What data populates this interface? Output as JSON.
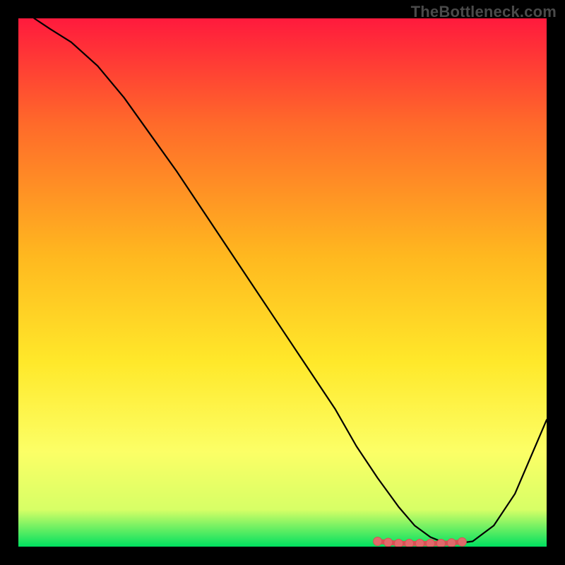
{
  "watermark": "TheBottleneck.com",
  "colors": {
    "page_background": "#000000",
    "gradient_top": "#ff1a3d",
    "gradient_mid1": "#ff6a2a",
    "gradient_mid2": "#ffb81f",
    "gradient_mid3": "#ffe82a",
    "gradient_mid4": "#fcff66",
    "gradient_mid5": "#d7ff66",
    "gradient_bottom": "#00e060",
    "curve": "#000000",
    "marker_fill": "#e06a6b",
    "marker_edge": "#d95053"
  },
  "chart_data": {
    "type": "line",
    "title": "",
    "xlabel": "",
    "ylabel": "",
    "xlim": [
      0,
      100
    ],
    "ylim": [
      0,
      100
    ],
    "grid": false,
    "legend": null,
    "curve": {
      "x": [
        3,
        6,
        10,
        15,
        20,
        25,
        30,
        35,
        40,
        45,
        50,
        55,
        60,
        64,
        68,
        72,
        75,
        78,
        80,
        83,
        86,
        90,
        94,
        100
      ],
      "y": [
        100,
        98,
        95.5,
        91,
        85,
        78,
        71,
        63.5,
        56,
        48.5,
        41,
        33.5,
        26,
        19,
        13,
        7.5,
        4,
        1.8,
        1.0,
        0.6,
        1.0,
        4,
        10,
        24
      ]
    },
    "markers": {
      "x": [
        68,
        70,
        72,
        74,
        76,
        78,
        80,
        82,
        84
      ],
      "y": [
        1.0,
        0.8,
        0.6,
        0.6,
        0.6,
        0.6,
        0.6,
        0.7,
        0.9
      ]
    }
  }
}
